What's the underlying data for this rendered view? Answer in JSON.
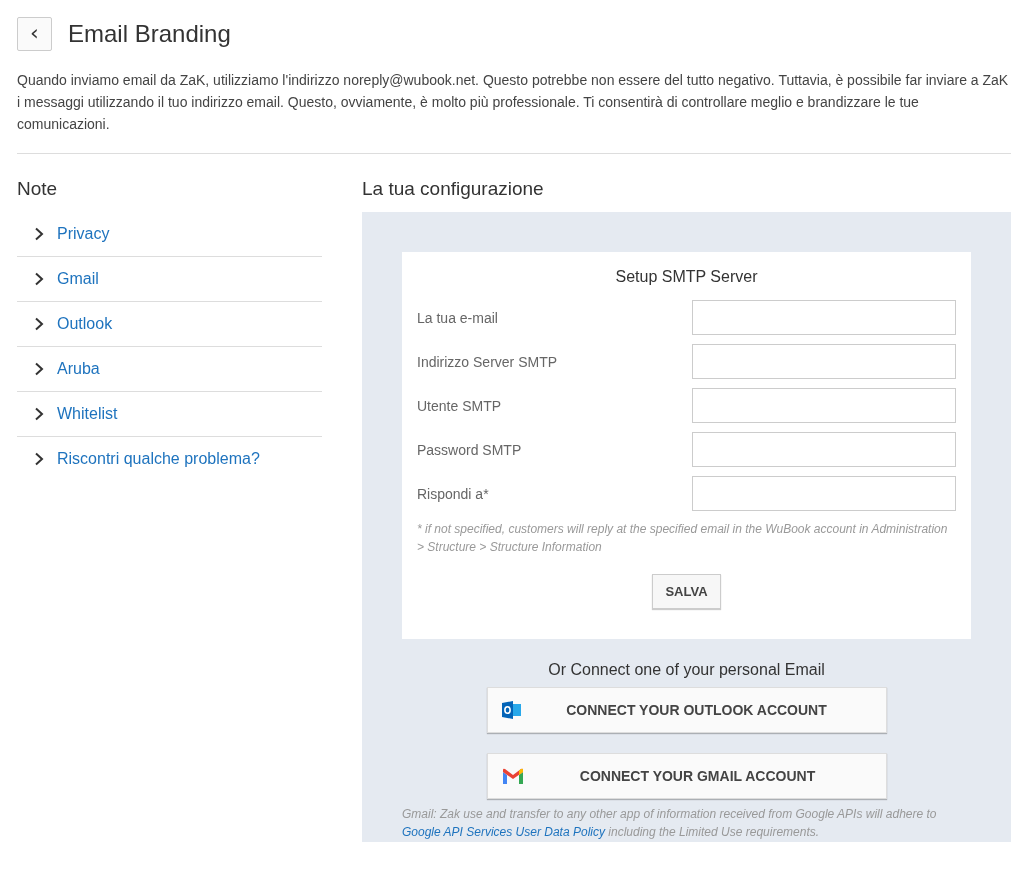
{
  "header": {
    "back_icon": "‹",
    "title": "Email Branding"
  },
  "intro": "Quando inviamo email da ZaK, utilizziamo l'indirizzo noreply@wubook.net. Questo potrebbe non essere del tutto negativo. Tuttavia, è possibile far inviare a ZaK i messaggi utilizzando il tuo indirizzo email. Questo, ovviamente, è molto più professionale. Ti consentirà di controllare meglio e brandizzare le tue comunicazioni.",
  "notes": {
    "title": "Note",
    "items": [
      {
        "label": "Privacy",
        "expanded": false
      },
      {
        "label": "Gmail",
        "expanded": false
      },
      {
        "label": "Outlook",
        "expanded": false
      },
      {
        "label": "Aruba",
        "expanded": false
      },
      {
        "label": "Whitelist",
        "expanded": false
      },
      {
        "label": "Riscontri qualche problema?",
        "expanded": false
      }
    ]
  },
  "config": {
    "title": "La tua configurazione",
    "smtp": {
      "title": "Setup SMTP Server",
      "fields": [
        {
          "label": "La tua e-mail"
        },
        {
          "label": "Indirizzo Server SMTP"
        },
        {
          "label": "Utente SMTP"
        },
        {
          "label": "Password SMTP"
        },
        {
          "label": "Rispondi a*"
        }
      ],
      "hint": "* if not specified, customers will reply at the specified email in the WuBook account in Administration > Structure > Structure Information",
      "save": "SALVA"
    },
    "connect_title": "Or Connect one of your personal Email",
    "connect_buttons": [
      {
        "kind": "outlook",
        "label": "CONNECT YOUR OUTLOOK ACCOUNT"
      },
      {
        "kind": "gmail",
        "label": "CONNECT YOUR GMAIL ACCOUNT"
      }
    ],
    "footnote": {
      "text": "Gmail: Zak use and transfer to any other app of information received from Google APIs will adhere to",
      "link": "Google API Services User Data Policy",
      "text_after": "including the Limited Use requirements."
    }
  }
}
